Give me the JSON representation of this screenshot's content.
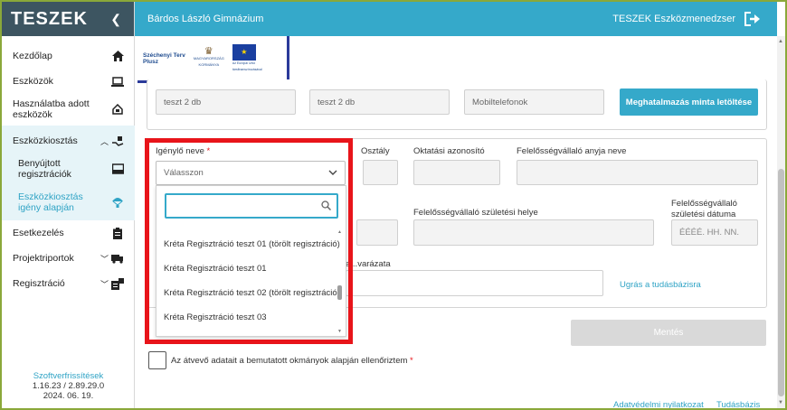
{
  "app": {
    "brand": "TESZEK",
    "collapse_icon": "chevron-left-icon",
    "school_name": "Bárdos László Gimnázium",
    "system_name": "TESZEK Eszközmenedzser",
    "logout_icon": "logout-icon"
  },
  "sidebar": {
    "items": [
      {
        "label": "Kezdőlap",
        "icon": "home-icon"
      },
      {
        "label": "Eszközök",
        "icon": "laptop-icon"
      },
      {
        "label": "Használatba adott eszközök",
        "icon": "hand-device-icon"
      },
      {
        "label": "Eszközkiosztás",
        "icon": "distribution-icon",
        "expanded": true
      },
      {
        "label": "Benyújtott regisztrációk",
        "icon": "inbox-icon"
      },
      {
        "label": "Eszközkiosztás igény alapján",
        "icon": "parachute-icon",
        "active": true
      },
      {
        "label": "Esetkezelés",
        "icon": "clipboard-icon"
      },
      {
        "label": "Projektriportok",
        "icon": "truck-icon"
      },
      {
        "label": "Regisztráció",
        "icon": "register-icon"
      }
    ],
    "version_link": "Szoftverfrissítések",
    "version": "1.16.23 / 2.89.29.0",
    "version_date": "2024. 06. 19."
  },
  "banner": {
    "logo1_line1": "Széchenyi Terv",
    "logo1_line2": "Plusz",
    "logo2": "MAGYARORSZÁG KORMÁNYA",
    "logo3": "Az Európai Unió társfinanszírozásával"
  },
  "top_row": {
    "field1_value": "teszt 2 db",
    "field2_value": "teszt 2 db",
    "field3_value": "Mobiltelefonok",
    "download_button": "Meghatalmazás minta letöltése"
  },
  "form": {
    "requester_label": "Igénylő neve",
    "required_marker": "*",
    "requester_placeholder": "Válasszon",
    "class_label": "Osztály",
    "edu_id_label": "Oktatási azonosító",
    "guardian_mother_label": "Felelősségvállaló anyja neve",
    "guardian_birthplace_label": "Felelősségvállaló születési helye",
    "guardian_birthdate_label": "Felelősségvállaló születési dátuma",
    "date_placeholder": "ÉÉÉÉ. HH. NN.",
    "partial_label": "a...varázata",
    "kb_link": "Ugrás a tudásbázisra",
    "save_button": "Mentés",
    "verify_checkbox_label": "Az átvevő adatait a bemutatott okmányok alapján ellenőriztem"
  },
  "dropdown": {
    "search_icon": "search-icon",
    "options": [
      "Kréta Regisztráció teszt 01 (törölt regisztráció)",
      "Kréta Regisztráció teszt 01",
      "Kréta Regisztráció teszt 02 (törölt regisztráció)",
      "Kréta Regisztráció teszt 03"
    ]
  },
  "footer": {
    "privacy_link": "Adatvédelmi nyilatkozat",
    "kb_link": "Tudásbázis"
  },
  "colors": {
    "sidebar_header": "#3d5561",
    "accent": "#35a9ca",
    "highlight_border": "#e8141a",
    "outer_border": "#8aa83a"
  }
}
